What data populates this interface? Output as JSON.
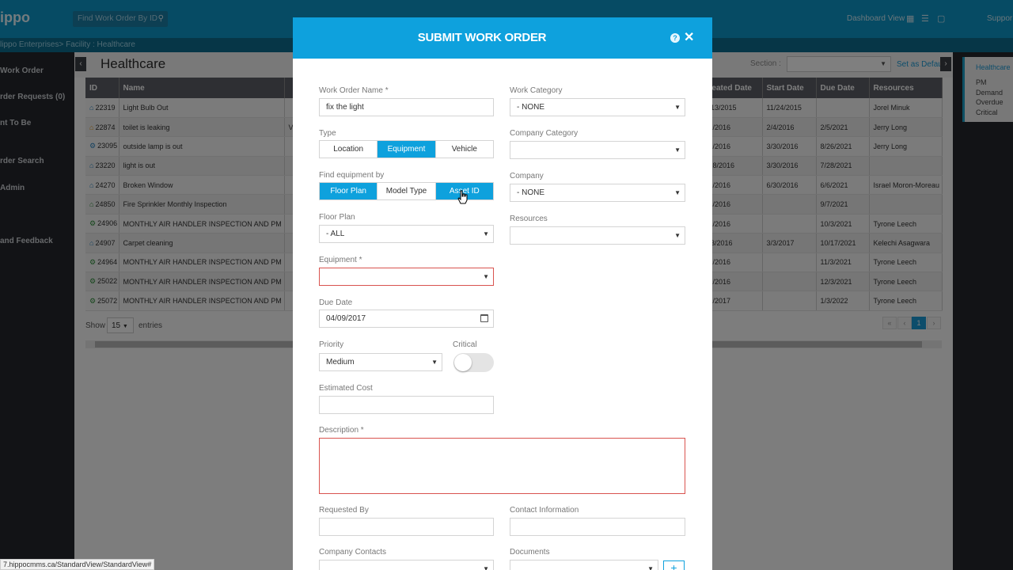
{
  "app": {
    "logo": "ippo",
    "search_placeholder": "Find Work Order By ID",
    "dashboard_view": "Dashboard View",
    "support": "Suppor"
  },
  "breadcrumb": "lippo Enterprises> Facility : Healthcare",
  "sidebar": {
    "items": [
      {
        "label": "Work Order"
      },
      {
        "label": "rder Requests (0)"
      },
      {
        "label": "nt To Be"
      },
      {
        "label": "rder Search"
      },
      {
        "label": "Admin"
      },
      {
        "label": "and Feedback"
      }
    ]
  },
  "page": {
    "title": "Healthcare",
    "section_label": "Section :",
    "set_default": "Set as Default"
  },
  "table": {
    "headers": [
      "ID",
      "Name",
      "",
      "reated Date",
      "Start Date",
      "Due Date",
      "Resources"
    ],
    "rows": [
      {
        "icon": "home-icon",
        "color": "blue",
        "id": "22319",
        "name": "Light Bulb Out",
        "col3": "",
        "created": "/13/2015",
        "start": "11/24/2015",
        "due": "",
        "resources": "Jorel Minuk"
      },
      {
        "icon": "home-icon",
        "color": "orange",
        "id": "22874",
        "name": "toilet is leaking",
        "col3": "V",
        "created": "2/2016",
        "start": "2/4/2016",
        "due": "2/5/2021",
        "resources": "Jerry Long"
      },
      {
        "icon": "gear-icon",
        "color": "blue",
        "id": "23095",
        "name": "outside lamp is out",
        "col3": "",
        "created": "3/2016",
        "start": "3/30/2016",
        "due": "8/26/2021",
        "resources": "Jerry Long"
      },
      {
        "icon": "home-icon",
        "color": "blue",
        "id": "23220",
        "name": "light is out",
        "col3": "",
        "created": "18/2016",
        "start": "3/30/2016",
        "due": "7/28/2021",
        "resources": ""
      },
      {
        "icon": "home-icon",
        "color": "blue",
        "id": "24270",
        "name": "Broken Window",
        "col3": "",
        "created": "1/2016",
        "start": "6/30/2016",
        "due": "6/6/2021",
        "resources": "Israel Moron-Moreau"
      },
      {
        "icon": "home-icon",
        "color": "green",
        "id": "24850",
        "name": "Fire Sprinkler Monthly Inspection",
        "col3": "",
        "created": "4/2016",
        "start": "",
        "due": "9/7/2021",
        "resources": ""
      },
      {
        "icon": "gear-icon",
        "color": "green",
        "id": "24906",
        "name": "MONTHLY AIR HANDLER INSPECTION AND PM",
        "col3": "",
        "created": "1/2016",
        "start": "",
        "due": "10/3/2021",
        "resources": "Tyrone Leech"
      },
      {
        "icon": "home-icon",
        "color": "blue",
        "id": "24907",
        "name": "Carpet cleaning",
        "col3": "",
        "created": "/3/2016",
        "start": "3/3/2017",
        "due": "10/17/2021",
        "resources": "Kelechi Asagwara"
      },
      {
        "icon": "gear-icon",
        "color": "green",
        "id": "24964",
        "name": "MONTHLY AIR HANDLER INSPECTION AND PM",
        "col3": "",
        "created": "1/2016",
        "start": "",
        "due": "11/3/2021",
        "resources": "Tyrone Leech"
      },
      {
        "icon": "gear-icon",
        "color": "green",
        "id": "25022",
        "name": "MONTHLY AIR HANDLER INSPECTION AND PM",
        "col3": "",
        "created": "1/2016",
        "start": "",
        "due": "12/3/2021",
        "resources": "Tyrone Leech"
      },
      {
        "icon": "gear-icon",
        "color": "green",
        "id": "25072",
        "name": "MONTHLY AIR HANDLER INSPECTION AND PM",
        "col3": "",
        "created": "1/2017",
        "start": "",
        "due": "1/3/2022",
        "resources": "Tyrone Leech"
      }
    ],
    "show_label": "Show",
    "show_value": "15",
    "entries_label": "entries",
    "current_page": "1"
  },
  "right_panel": {
    "title": "Healthcare",
    "lines": [
      "PM",
      "Demand",
      "Overdue",
      "Critical"
    ]
  },
  "status_url": "7.hippocmms.ca/StandardView/StandardView#",
  "modal": {
    "title": "SUBMIT WORK ORDER",
    "work_order_name_label": "Work Order Name *",
    "work_order_name_value": "fix the light",
    "type_label": "Type",
    "type_options": [
      "Location",
      "Equipment",
      "Vehicle"
    ],
    "find_equipment_label": "Find equipment by",
    "find_options": [
      "Floor Plan",
      "Model Type",
      "Asset ID"
    ],
    "floor_plan_label": "Floor Plan",
    "floor_plan_value": "- ALL",
    "equipment_label": "Equipment *",
    "equipment_value": "",
    "due_date_label": "Due Date",
    "due_date_value": "04/09/2017",
    "priority_label": "Priority",
    "priority_value": "Medium",
    "critical_label": "Critical",
    "critical_on": false,
    "estimated_cost_label": "Estimated Cost",
    "estimated_cost_value": "",
    "description_label": "Description *",
    "requested_by_label": "Requested By",
    "contact_info_label": "Contact Information",
    "company_contacts_label": "Company Contacts",
    "documents_label": "Documents",
    "work_category_label": "Work Category",
    "work_category_value": "- NONE",
    "company_category_label": "Company Category",
    "company_category_value": "",
    "company_label": "Company",
    "company_value": "- NONE",
    "resources_label": "Resources",
    "resources_value": ""
  },
  "colors": {
    "accent": "#0ea1dd",
    "topbar": "#0d97c9",
    "error": "#d9534f",
    "sidebar": "#24262d"
  }
}
